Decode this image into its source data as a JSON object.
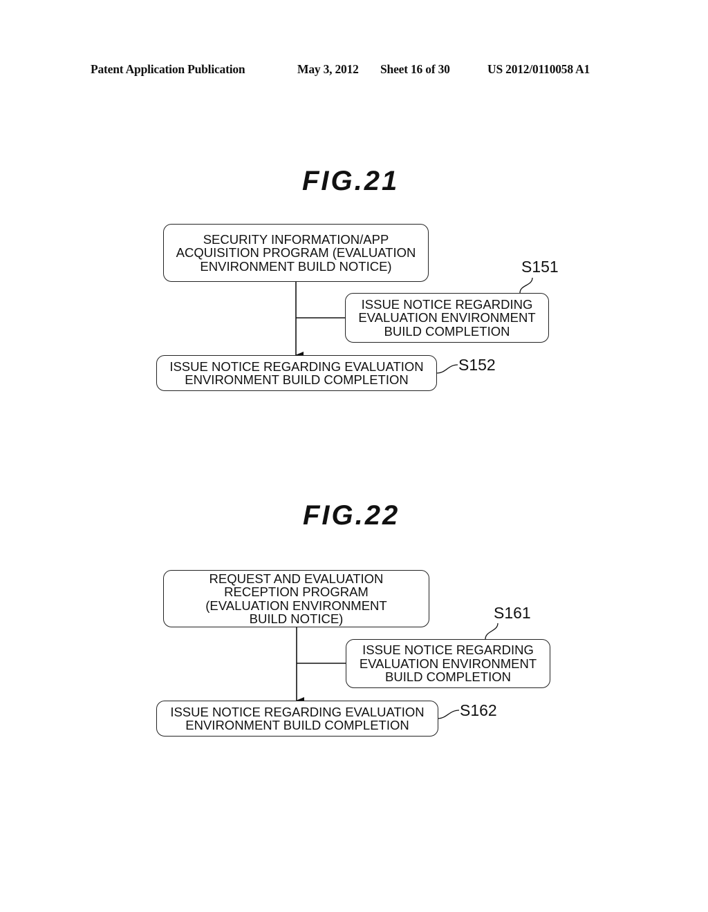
{
  "header": {
    "publication": "Patent Application Publication",
    "date": "May 3, 2012",
    "sheet": "Sheet 16 of 30",
    "number": "US 2012/0110058 A1"
  },
  "figures": [
    {
      "title": "FIG.21",
      "program_box": "SECURITY INFORMATION/APP\nACQUISITION PROGRAM (EVALUATION\nENVIRONMENT BUILD NOTICE)",
      "step_a": {
        "label": "S151",
        "text": "ISSUE NOTICE REGARDING\nEVALUATION ENVIRONMENT\nBUILD  COMPLETION"
      },
      "step_b": {
        "label": "S152",
        "text": "ISSUE NOTICE REGARDING EVALUATION\nENVIRONMENT BUILD  COMPLETION"
      }
    },
    {
      "title": "FIG.22",
      "program_box": "REQUEST AND EVALUATION\nRECEPTION PROGRAM\n(EVALUATION ENVIRONMENT\nBUILD NOTICE)",
      "step_a": {
        "label": "S161",
        "text": "ISSUE NOTICE REGARDING\nEVALUATION ENVIRONMENT\nBUILD  COMPLETION"
      },
      "step_b": {
        "label": "S162",
        "text": "ISSUE NOTICE REGARDING EVALUATION\nENVIRONMENT BUILD  COMPLETION"
      }
    }
  ]
}
